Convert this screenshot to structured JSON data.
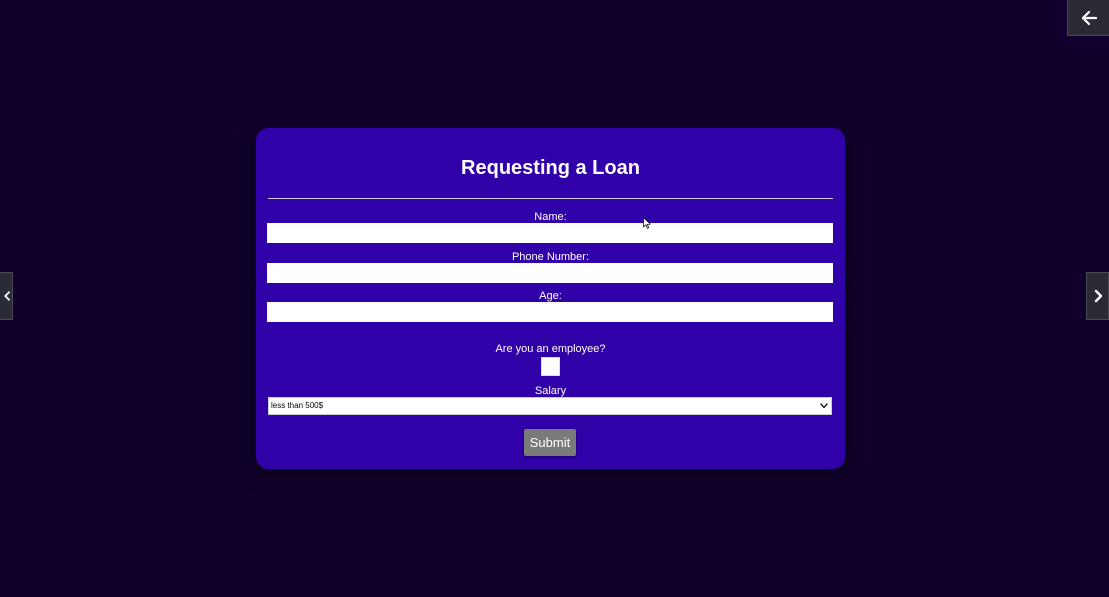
{
  "colors": {
    "background": "#10002b",
    "card": "#3000a8",
    "submit_button": "#7a7a7a",
    "nav_button": "#2b2b36"
  },
  "icons": {
    "back": "arrow-left-icon",
    "prev": "chevron-left-icon",
    "next": "chevron-right-icon",
    "select": "chevron-down-icon",
    "cursor": "mouse-pointer-icon"
  },
  "form": {
    "title": "Requesting a Loan",
    "fields": [
      {
        "label": "Name:",
        "value": "",
        "placeholder": ""
      },
      {
        "label": "Phone Number:",
        "value": "",
        "placeholder": ""
      },
      {
        "label": "Age:",
        "value": "",
        "placeholder": ""
      }
    ],
    "employee": {
      "label": "Are you an employee?",
      "checked": false
    },
    "salary": {
      "label": "Salary",
      "selected": "less than 500$"
    },
    "submit_label": "Submit"
  }
}
